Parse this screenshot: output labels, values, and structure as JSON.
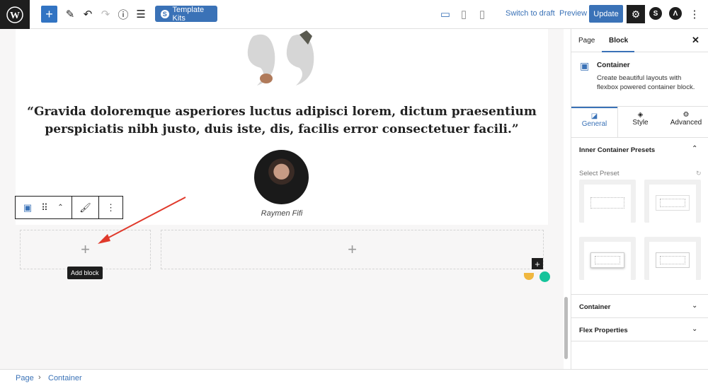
{
  "toolbar": {
    "template_kits": "Template Kits",
    "switch_draft": "Switch to draft",
    "preview": "Preview",
    "update": "Update"
  },
  "content": {
    "quote": "“Gravida doloremque asperiores luctus adipisci lorem, dictum praesentium perspiciatis nibh justo, duis iste, dis, facilis error consectetuer facili.”",
    "author": "Raymen Fifi",
    "tooltip": "Add block"
  },
  "sidebar": {
    "tabs": [
      "Page",
      "Block"
    ],
    "block_name": "Container",
    "block_desc": "Create beautiful layouts with flexbox powered container block.",
    "subtabs": [
      "General",
      "Style",
      "Advanced"
    ],
    "presets_title": "Inner Container Presets",
    "select_preset": "Select Preset",
    "panels": [
      "Container",
      "Flex Properties"
    ]
  },
  "breadcrumb": [
    "Page",
    "Container"
  ],
  "colors": {
    "accent": "#3a72b7",
    "arrow": "#e0392b"
  }
}
